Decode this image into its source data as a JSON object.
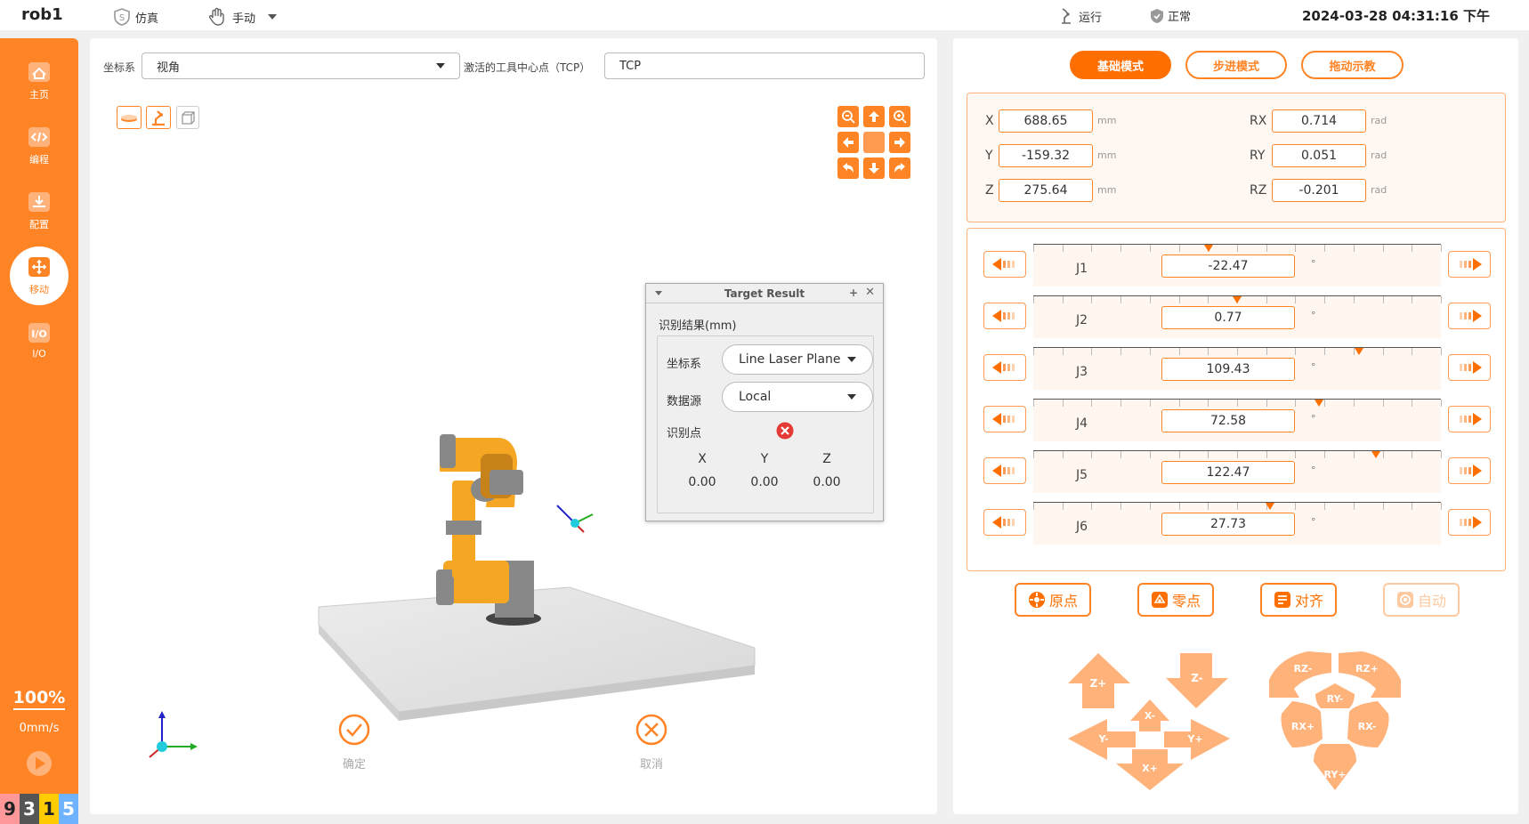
{
  "topbar": {
    "app_title": "rob1",
    "sim_label": "仿真",
    "mode_label": "手动",
    "run_label": "运行",
    "status_label": "正常",
    "datetime": "2024-03-28 04:31:16 下午"
  },
  "sidebar": {
    "items": [
      {
        "label": "主页",
        "icon": "home-icon"
      },
      {
        "label": "编程",
        "icon": "code-icon"
      },
      {
        "label": "配置",
        "icon": "download-icon"
      },
      {
        "label": "移动",
        "icon": "move-icon"
      },
      {
        "label": "I/O",
        "icon": "io-icon"
      }
    ],
    "active_index": 3,
    "speed_percent": "100%",
    "speed_value": "0mm/s",
    "chips": [
      "9",
      "3",
      "1",
      "5"
    ]
  },
  "viewport": {
    "coord_label": "坐标系",
    "coord_value": "视角",
    "tcp_label": "激活的工具中心点（TCP）",
    "tcp_value": "TCP",
    "confirm_label": "确定",
    "cancel_label": "取消"
  },
  "dialog": {
    "title": "Target Result",
    "subtitle": "识别结果(mm)",
    "coord_label": "坐标系",
    "coord_value": "Line Laser Plane",
    "source_label": "数据源",
    "source_value": "Local",
    "point_label": "识别点",
    "headers": [
      "X",
      "Y",
      "Z"
    ],
    "values": [
      "0.00",
      "0.00",
      "0.00"
    ]
  },
  "modes": {
    "basic": "基础模式",
    "step": "步进模式",
    "drag": "拖动示教",
    "active": "basic"
  },
  "cartesian": {
    "x": {
      "label": "X",
      "value": "688.65",
      "unit": "mm"
    },
    "y": {
      "label": "Y",
      "value": "-159.32",
      "unit": "mm"
    },
    "z": {
      "label": "Z",
      "value": "275.64",
      "unit": "mm"
    },
    "rx": {
      "label": "RX",
      "value": "0.714",
      "unit": "rad"
    },
    "ry": {
      "label": "RY",
      "value": "0.051",
      "unit": "rad"
    },
    "rz": {
      "label": "RZ",
      "value": "-0.201",
      "unit": "rad"
    }
  },
  "joints": [
    {
      "name": "J1",
      "value": "-22.47",
      "unit": "°",
      "marker_fraction": 0.43
    },
    {
      "name": "J2",
      "value": "0.77",
      "unit": "°",
      "marker_fraction": 0.5
    },
    {
      "name": "J3",
      "value": "109.43",
      "unit": "°",
      "marker_fraction": 0.8
    },
    {
      "name": "J4",
      "value": "72.58",
      "unit": "°",
      "marker_fraction": 0.7
    },
    {
      "name": "J5",
      "value": "122.47",
      "unit": "°",
      "marker_fraction": 0.84
    },
    {
      "name": "J6",
      "value": "27.73",
      "unit": "°",
      "marker_fraction": 0.58
    }
  ],
  "functions": {
    "origin": "原点",
    "zero": "零点",
    "align": "对齐",
    "auto": "自动"
  },
  "jog_linear": {
    "zp": "Z+",
    "zm": "Z-",
    "xm": "X-",
    "ym": "Y-",
    "yp": "Y+",
    "xp": "X+"
  },
  "jog_rot": {
    "rzm": "RZ-",
    "rzp": "RZ+",
    "rym": "RY-",
    "rxp": "RX+",
    "rxm": "RX-",
    "ryp": "RY+"
  },
  "colors": {
    "accent": "#ff8426",
    "accent_dark": "#ff6f00",
    "error": "#e53935"
  }
}
